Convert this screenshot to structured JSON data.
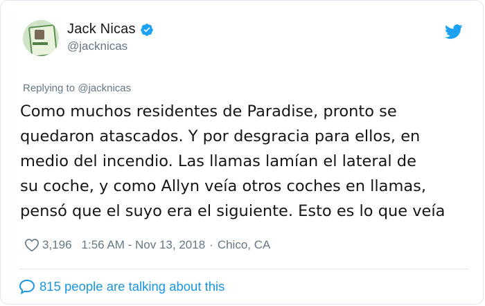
{
  "author": {
    "name": "Jack Nicas",
    "handle": "@jacknicas",
    "verified_icon": "verified-badge-icon"
  },
  "reply": {
    "text": "Replying to @jacknicas"
  },
  "tweet": {
    "text": "Como muchos residentes de Paradise, pronto se\nquedaron atascados. Y por desgracia para ellos, en\nmedio del incendio. Las llamas lamían el lateral de\nsu coche, y como Allyn veía otros coches en llamas,\npensó que el suyo era el siguiente. Esto es lo que veía"
  },
  "meta": {
    "likes": "3,196",
    "time": "1:56 AM - Nov 13, 2018",
    "separator": "·",
    "location": "Chico, CA"
  },
  "footer": {
    "talking": "815 people are talking about this"
  },
  "colors": {
    "brand_blue": "#1da1f2",
    "link_blue": "#1b95e0",
    "muted_gray": "#657786",
    "text": "#14171a"
  }
}
